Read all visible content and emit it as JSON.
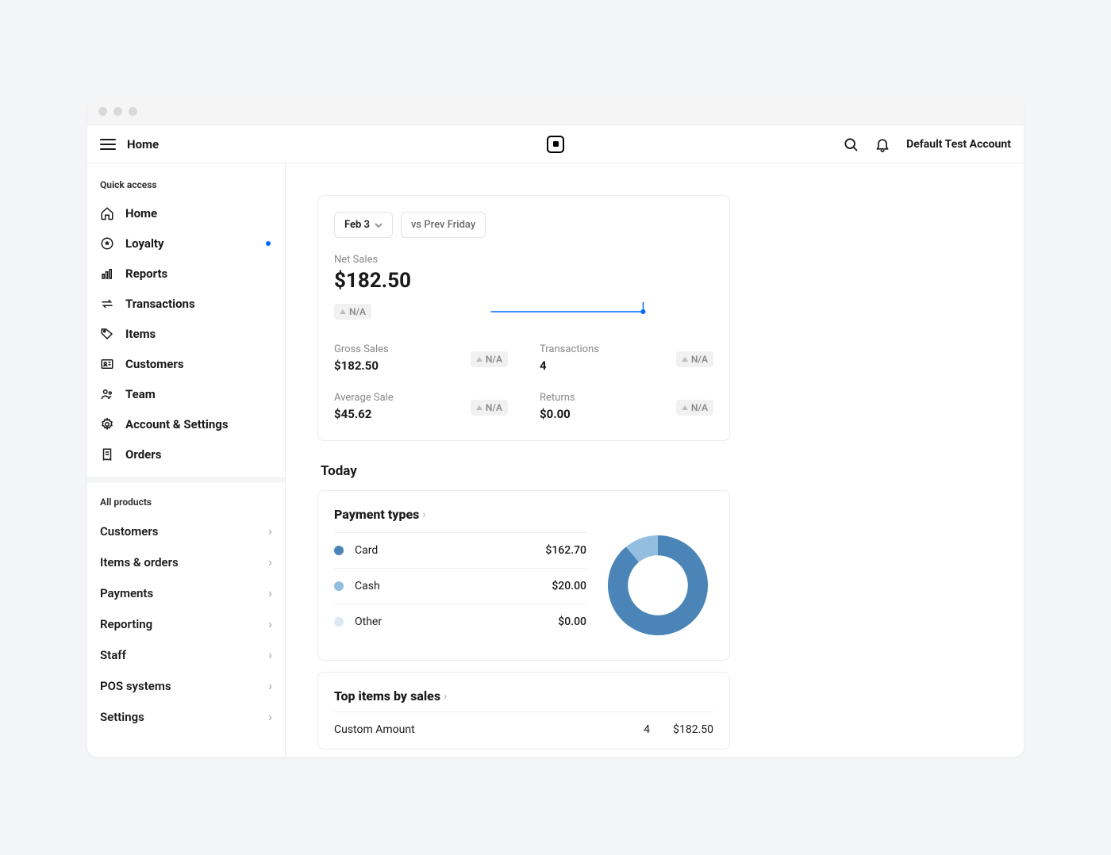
{
  "header": {
    "title": "Home",
    "account": "Default Test Account"
  },
  "sidebar": {
    "quick_title": "Quick access",
    "quick": [
      {
        "label": "Home"
      },
      {
        "label": "Loyalty",
        "indicator": true
      },
      {
        "label": "Reports"
      },
      {
        "label": "Transactions"
      },
      {
        "label": "Items"
      },
      {
        "label": "Customers"
      },
      {
        "label": "Team"
      },
      {
        "label": "Account & Settings"
      },
      {
        "label": "Orders"
      }
    ],
    "all_title": "All products",
    "all": [
      {
        "label": "Customers"
      },
      {
        "label": "Items & orders"
      },
      {
        "label": "Payments"
      },
      {
        "label": "Reporting"
      },
      {
        "label": "Staff"
      },
      {
        "label": "POS systems"
      },
      {
        "label": "Settings"
      }
    ]
  },
  "summary": {
    "date_label": "Feb 3",
    "compare_label": "vs Prev Friday",
    "net_label": "Net Sales",
    "net_value": "$182.50",
    "na": "N/A",
    "metrics": [
      {
        "label": "Gross Sales",
        "value": "$182.50"
      },
      {
        "label": "Transactions",
        "value": "4"
      },
      {
        "label": "Average Sale",
        "value": "$45.62"
      },
      {
        "label": "Returns",
        "value": "$0.00"
      }
    ]
  },
  "today_title": "Today",
  "payment_types": {
    "title": "Payment types",
    "rows": [
      {
        "name": "Card",
        "value": "$162.70",
        "color": "#4b85b7"
      },
      {
        "name": "Cash",
        "value": "$20.00",
        "color": "#93bedf"
      },
      {
        "name": "Other",
        "value": "$0.00",
        "color": "#dce9f3"
      }
    ]
  },
  "top_items": {
    "title": "Top items by sales",
    "rows": [
      {
        "name": "Custom Amount",
        "qty": "4",
        "value": "$182.50"
      }
    ]
  },
  "chart_data": {
    "sparkline": {
      "type": "line",
      "x": [
        0,
        1
      ],
      "values": [
        182.5,
        182.5
      ],
      "color": "#006aff",
      "end_marker": true
    },
    "donut": {
      "type": "pie",
      "title": "Payment types",
      "series": [
        {
          "name": "Card",
          "value": 162.7,
          "color": "#4b85b7"
        },
        {
          "name": "Cash",
          "value": 20.0,
          "color": "#93bedf"
        },
        {
          "name": "Other",
          "value": 0.0,
          "color": "#dce9f3"
        }
      ],
      "total": 182.7
    }
  }
}
